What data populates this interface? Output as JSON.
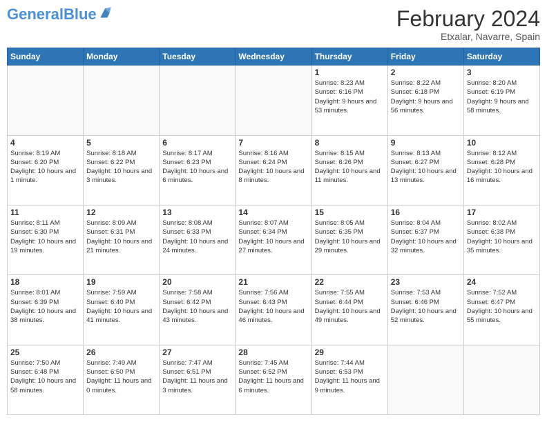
{
  "header": {
    "logo_general": "General",
    "logo_blue": "Blue",
    "main_title": "February 2024",
    "subtitle": "Etxalar, Navarre, Spain"
  },
  "days_of_week": [
    "Sunday",
    "Monday",
    "Tuesday",
    "Wednesday",
    "Thursday",
    "Friday",
    "Saturday"
  ],
  "weeks": [
    [
      {
        "num": "",
        "info": ""
      },
      {
        "num": "",
        "info": ""
      },
      {
        "num": "",
        "info": ""
      },
      {
        "num": "",
        "info": ""
      },
      {
        "num": "1",
        "info": "Sunrise: 8:23 AM\nSunset: 6:16 PM\nDaylight: 9 hours and 53 minutes."
      },
      {
        "num": "2",
        "info": "Sunrise: 8:22 AM\nSunset: 6:18 PM\nDaylight: 9 hours and 56 minutes."
      },
      {
        "num": "3",
        "info": "Sunrise: 8:20 AM\nSunset: 6:19 PM\nDaylight: 9 hours and 58 minutes."
      }
    ],
    [
      {
        "num": "4",
        "info": "Sunrise: 8:19 AM\nSunset: 6:20 PM\nDaylight: 10 hours and 1 minute."
      },
      {
        "num": "5",
        "info": "Sunrise: 8:18 AM\nSunset: 6:22 PM\nDaylight: 10 hours and 3 minutes."
      },
      {
        "num": "6",
        "info": "Sunrise: 8:17 AM\nSunset: 6:23 PM\nDaylight: 10 hours and 6 minutes."
      },
      {
        "num": "7",
        "info": "Sunrise: 8:16 AM\nSunset: 6:24 PM\nDaylight: 10 hours and 8 minutes."
      },
      {
        "num": "8",
        "info": "Sunrise: 8:15 AM\nSunset: 6:26 PM\nDaylight: 10 hours and 11 minutes."
      },
      {
        "num": "9",
        "info": "Sunrise: 8:13 AM\nSunset: 6:27 PM\nDaylight: 10 hours and 13 minutes."
      },
      {
        "num": "10",
        "info": "Sunrise: 8:12 AM\nSunset: 6:28 PM\nDaylight: 10 hours and 16 minutes."
      }
    ],
    [
      {
        "num": "11",
        "info": "Sunrise: 8:11 AM\nSunset: 6:30 PM\nDaylight: 10 hours and 19 minutes."
      },
      {
        "num": "12",
        "info": "Sunrise: 8:09 AM\nSunset: 6:31 PM\nDaylight: 10 hours and 21 minutes."
      },
      {
        "num": "13",
        "info": "Sunrise: 8:08 AM\nSunset: 6:33 PM\nDaylight: 10 hours and 24 minutes."
      },
      {
        "num": "14",
        "info": "Sunrise: 8:07 AM\nSunset: 6:34 PM\nDaylight: 10 hours and 27 minutes."
      },
      {
        "num": "15",
        "info": "Sunrise: 8:05 AM\nSunset: 6:35 PM\nDaylight: 10 hours and 29 minutes."
      },
      {
        "num": "16",
        "info": "Sunrise: 8:04 AM\nSunset: 6:37 PM\nDaylight: 10 hours and 32 minutes."
      },
      {
        "num": "17",
        "info": "Sunrise: 8:02 AM\nSunset: 6:38 PM\nDaylight: 10 hours and 35 minutes."
      }
    ],
    [
      {
        "num": "18",
        "info": "Sunrise: 8:01 AM\nSunset: 6:39 PM\nDaylight: 10 hours and 38 minutes."
      },
      {
        "num": "19",
        "info": "Sunrise: 7:59 AM\nSunset: 6:40 PM\nDaylight: 10 hours and 41 minutes."
      },
      {
        "num": "20",
        "info": "Sunrise: 7:58 AM\nSunset: 6:42 PM\nDaylight: 10 hours and 43 minutes."
      },
      {
        "num": "21",
        "info": "Sunrise: 7:56 AM\nSunset: 6:43 PM\nDaylight: 10 hours and 46 minutes."
      },
      {
        "num": "22",
        "info": "Sunrise: 7:55 AM\nSunset: 6:44 PM\nDaylight: 10 hours and 49 minutes."
      },
      {
        "num": "23",
        "info": "Sunrise: 7:53 AM\nSunset: 6:46 PM\nDaylight: 10 hours and 52 minutes."
      },
      {
        "num": "24",
        "info": "Sunrise: 7:52 AM\nSunset: 6:47 PM\nDaylight: 10 hours and 55 minutes."
      }
    ],
    [
      {
        "num": "25",
        "info": "Sunrise: 7:50 AM\nSunset: 6:48 PM\nDaylight: 10 hours and 58 minutes."
      },
      {
        "num": "26",
        "info": "Sunrise: 7:49 AM\nSunset: 6:50 PM\nDaylight: 11 hours and 0 minutes."
      },
      {
        "num": "27",
        "info": "Sunrise: 7:47 AM\nSunset: 6:51 PM\nDaylight: 11 hours and 3 minutes."
      },
      {
        "num": "28",
        "info": "Sunrise: 7:45 AM\nSunset: 6:52 PM\nDaylight: 11 hours and 6 minutes."
      },
      {
        "num": "29",
        "info": "Sunrise: 7:44 AM\nSunset: 6:53 PM\nDaylight: 11 hours and 9 minutes."
      },
      {
        "num": "",
        "info": ""
      },
      {
        "num": "",
        "info": ""
      }
    ]
  ]
}
